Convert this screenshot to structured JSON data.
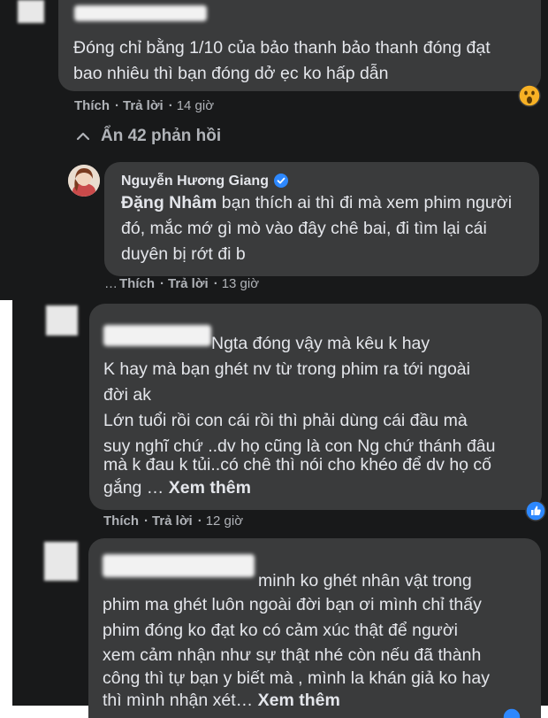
{
  "comment1": {
    "lines": [
      "Đóng chỉ bằng 1/10 của bảo thanh bảo thanh đóng đạt",
      "bao nhiêu thì bạn đóng dở ẹc ko hấp dẫn"
    ],
    "like": "Thích",
    "reply": "Trả lời",
    "time": "14 giờ",
    "reaction": "wow-reaction-icon"
  },
  "replies_toggle": {
    "chevron": "chevron-up-icon",
    "label": "Ẩn 42 phản hồi"
  },
  "comment2": {
    "author": "Nguyễn Hương Giang",
    "verified": "verified-badge-icon",
    "mention": "Đặng Nhâm",
    "line1_rest": " bạn thích ai thì đi mà xem phim người",
    "lines": [
      "đó, mắc mớ gì mò vào đây chê bai, đi tìm lại cái",
      "duyên bị rớt đi b"
    ],
    "like": "Thích",
    "reply": "Trả lời",
    "time": "13 giờ",
    "prefix": "…"
  },
  "comment3": {
    "line1": "Ngta đóng vậy mà kêu k hay",
    "lines": [
      "K hay mà bạn ghét nv từ trong phim ra tới ngoài",
      "đời ak",
      "Lớn tuổi rồi con cái rồi thì phải dùng cái đầu mà",
      "suy nghĩ chứ ..dv họ cũng là con Ng chứ thánh đâu",
      "mà k đau k tủi..có chê thì nói cho khéo để dv họ cố"
    ],
    "last_line": "gắng …",
    "see_more": "Xem thêm",
    "like": "Thích",
    "reply": "Trả lời",
    "time": "12 giờ",
    "reaction_count": "1",
    "reaction": "like-reaction-icon"
  },
  "comment4": {
    "line1": "minh ko ghét nhân vật trong",
    "lines": [
      "phim ma ghét luôn ngoài đời bạn ơi mình chỉ thấy",
      "phim đóng ko đạt ko có cảm xúc thật để người",
      "xem cảm nhận như sự thật nhé còn nếu đã thành",
      "công thì tự bạn y biết mà , mình la khán giả ko hay"
    ],
    "last_line": "thì mình nhận xét…",
    "see_more": "Xem thêm"
  },
  "colors": {
    "background": "#18191a",
    "bubble": "#3a3b3c",
    "text": "#e4e6eb",
    "meta": "#b0b3b8",
    "verified": "#2d88ff"
  }
}
